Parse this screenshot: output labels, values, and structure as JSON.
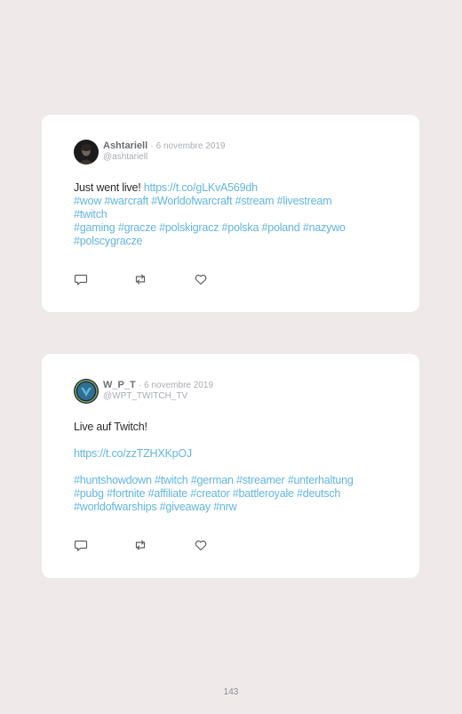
{
  "tweets": [
    {
      "name": "Ashtariell",
      "date": "6 novembre 2019",
      "handle": "@ashtariell",
      "avatar_icon": "user-avatar-dark",
      "line1_text": "Just went live! ",
      "line1_link": "https://t.co/gLKvA569dh",
      "tags1": "#wow #warcraft #Worldofwarcraft #stream #livestream",
      "tags2": "#twitch",
      "tags3": "#gaming #gracze #polskigracz #polska #poland #nazywo",
      "tags4": "#polscygracze"
    },
    {
      "name": "W_P_T",
      "date": "6 novembre 2019",
      "handle": "@WPT_TWITCH_TV",
      "avatar_icon": "user-avatar-blue",
      "line1_text": "Live auf Twitch!",
      "link": "https://t.co/zzTZHXKpOJ",
      "tags1": "#huntshowdown #twitch #german #streamer #unterhaltung",
      "tags2": "#pubg #fortnite #affiliate #creator #battleroyale #deutsch",
      "tags3": "#worldofwarships #giveaway #nrw"
    }
  ],
  "separator": "·",
  "page_number": "143",
  "colors": {
    "link": "#62b5e0",
    "background": "#efe9e9",
    "card": "#ffffff"
  }
}
